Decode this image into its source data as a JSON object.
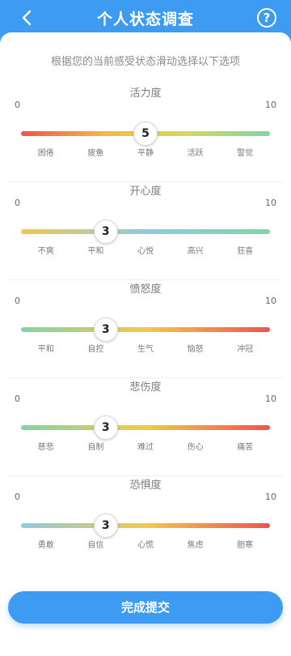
{
  "header": {
    "title": "个人状态调查",
    "back_icon": "chevron-left-icon",
    "help_icon": "question-circle-icon",
    "help_glyph": "?"
  },
  "instruction": "根据您的当前感受状态滑动选择以下选项",
  "sliders": [
    {
      "title": "活力度",
      "min": "0",
      "max": "10",
      "value": 5,
      "gradient": [
        "#ef5350",
        "#f5b942",
        "#d4d95a",
        "#7fd6a6"
      ],
      "ticks": [
        "困倦",
        "疲惫",
        "平静",
        "活跃",
        "警觉"
      ]
    },
    {
      "title": "开心度",
      "min": "0",
      "max": "10",
      "value": 3,
      "gradient": [
        "#f3c94a",
        "#8ecbe0",
        "#7fd6a6"
      ],
      "ticks": [
        "不爽",
        "平和",
        "心悦",
        "高兴",
        "狂喜"
      ]
    },
    {
      "title": "愤怒度",
      "min": "0",
      "max": "10",
      "value": 3,
      "gradient": [
        "#7fd6a6",
        "#f3c94a",
        "#ef5350"
      ],
      "ticks": [
        "平和",
        "自控",
        "生气",
        "恼怒",
        "冲冠"
      ]
    },
    {
      "title": "悲伤度",
      "min": "0",
      "max": "10",
      "value": 3,
      "gradient": [
        "#7fd6a6",
        "#f3c94a",
        "#ef5350"
      ],
      "ticks": [
        "慈悲",
        "自制",
        "难过",
        "伤心",
        "痛苦"
      ]
    },
    {
      "title": "恐惧度",
      "min": "0",
      "max": "10",
      "value": 3,
      "gradient": [
        "#8ecbe0",
        "#f3c94a",
        "#ef5350"
      ],
      "ticks": [
        "勇敢",
        "自信",
        "心慌",
        "焦虑",
        "胆寒"
      ]
    }
  ],
  "submit_label": "完成提交",
  "colors": {
    "primary": "#3d9cf2",
    "card": "#ffffff"
  }
}
